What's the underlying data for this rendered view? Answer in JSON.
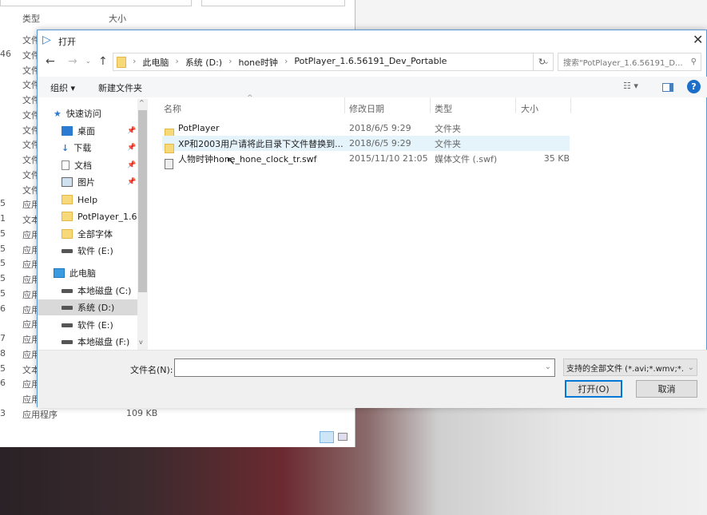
{
  "background_window": {
    "col_type": "类型",
    "col_size": "大小",
    "rows": [
      {
        "n": "",
        "t": "文件",
        "s": ""
      },
      {
        "n": "46",
        "t": "文件",
        "s": ""
      },
      {
        "n": "",
        "t": "文件",
        "s": ""
      },
      {
        "n": "",
        "t": "文件",
        "s": ""
      },
      {
        "n": "",
        "t": "文件",
        "s": ""
      },
      {
        "n": "",
        "t": "文件",
        "s": ""
      },
      {
        "n": "",
        "t": "文件",
        "s": ""
      },
      {
        "n": "",
        "t": "文件",
        "s": ""
      },
      {
        "n": "",
        "t": "文件",
        "s": ""
      },
      {
        "n": "",
        "t": "文件",
        "s": ""
      },
      {
        "n": "",
        "t": "文件",
        "s": ""
      },
      {
        "n": "5",
        "t": "应用",
        "s": ""
      },
      {
        "n": "1",
        "t": "文本",
        "s": ""
      },
      {
        "n": "5",
        "t": "应用",
        "s": ""
      },
      {
        "n": "5",
        "t": "应用",
        "s": ""
      },
      {
        "n": "5",
        "t": "应用",
        "s": ""
      },
      {
        "n": "5",
        "t": "应用",
        "s": ""
      },
      {
        "n": "5",
        "t": "应用",
        "s": ""
      },
      {
        "n": "6",
        "t": "应用",
        "s": ""
      },
      {
        "n": "",
        "t": "应用",
        "s": ""
      },
      {
        "n": "7",
        "t": "应用",
        "s": ""
      },
      {
        "n": "8",
        "t": "应用",
        "s": ""
      },
      {
        "n": "5",
        "t": "文本",
        "s": ""
      },
      {
        "n": "6",
        "t": "应用",
        "s": ""
      },
      {
        "n": "",
        "t": "应用",
        "s": ""
      },
      {
        "n": "3",
        "t": "应用程序",
        "s": "109 KB"
      }
    ]
  },
  "dialog": {
    "title": "打开",
    "breadcrumb": [
      "此电脑",
      "系统 (D:)",
      "hone时钟",
      "PotPlayer_1.6.56191_Dev_Portable"
    ],
    "search_placeholder": "搜索\"PotPlayer_1.6.56191_D...",
    "toolbar": {
      "organize": "组织 ▾",
      "new_folder": "新建文件夹"
    },
    "nav": [
      {
        "label": "快速访问",
        "icon": "star",
        "pin": false
      },
      {
        "label": "桌面",
        "icon": "desktop",
        "pin": true
      },
      {
        "label": "下载",
        "icon": "download",
        "pin": true
      },
      {
        "label": "文档",
        "icon": "document",
        "pin": true
      },
      {
        "label": "图片",
        "icon": "picture",
        "pin": true
      },
      {
        "label": "Help",
        "icon": "folder",
        "pin": false
      },
      {
        "label": "PotPlayer_1.6.5",
        "icon": "folder",
        "pin": false
      },
      {
        "label": "全部字体",
        "icon": "folder",
        "pin": false
      },
      {
        "label": "软件 (E:)",
        "icon": "drive",
        "pin": false
      },
      {
        "label": "此电脑",
        "icon": "pc",
        "pin": false
      },
      {
        "label": "本地磁盘 (C:)",
        "icon": "drive",
        "pin": false
      },
      {
        "label": "系统 (D:)",
        "icon": "drive",
        "pin": false
      },
      {
        "label": "软件 (E:)",
        "icon": "drive",
        "pin": false
      },
      {
        "label": "本地磁盘 (F:)",
        "icon": "drive",
        "pin": false
      }
    ],
    "columns": {
      "name": "名称",
      "date": "修改日期",
      "type": "类型",
      "size": "大小"
    },
    "files": [
      {
        "name": "PotPlayer",
        "date": "2018/6/5 9:29",
        "type": "文件夹",
        "size": ""
      },
      {
        "name": "XP和2003用户请将此目录下文件替换到...",
        "date": "2018/6/5 9:29",
        "type": "文件夹",
        "size": ""
      },
      {
        "name": "人物时钟hone_hone_clock_tr.swf",
        "date": "2015/11/10 21:05",
        "type": "媒体文件 (.swf)",
        "size": "35 KB"
      }
    ],
    "filename_label": "文件名(N):",
    "filename_value": "",
    "filter": "支持的全部文件 (*.avi;*.wmv;*.",
    "open": "打开(O)",
    "cancel": "取消"
  }
}
